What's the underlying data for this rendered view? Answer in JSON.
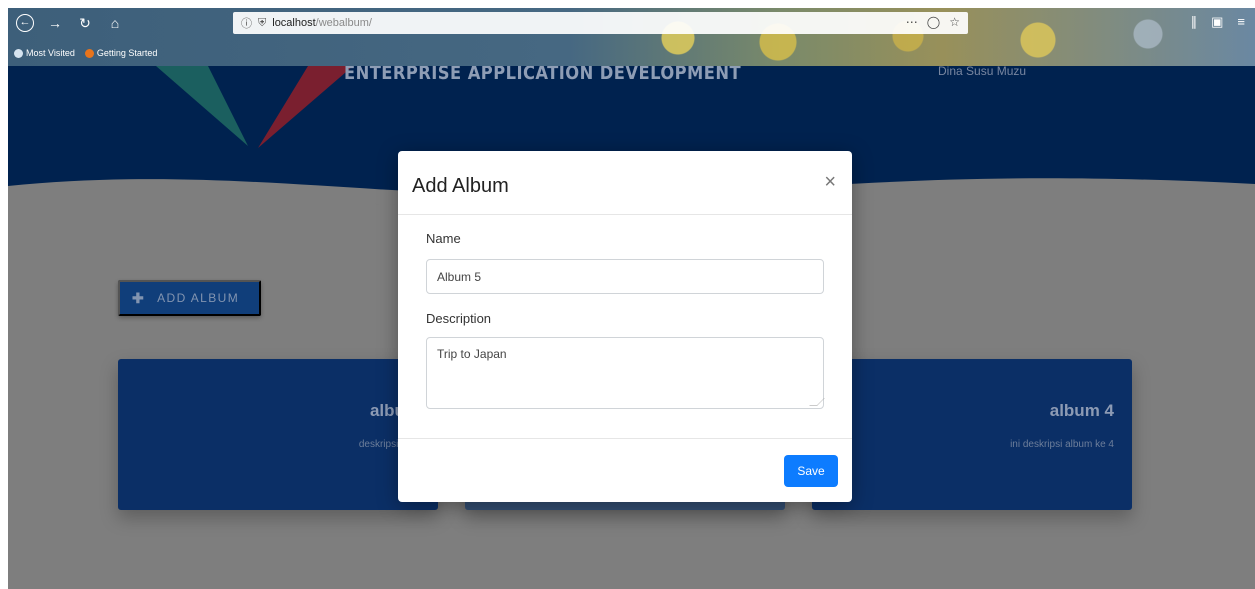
{
  "browser": {
    "url_host": "localhost",
    "url_path": "/webalbum/",
    "bookmarks": [
      "Most Visited",
      "Getting Started"
    ]
  },
  "header": {
    "title": "ENTERPRISE APPLICATION DEVELOPMENT",
    "user_text": "Dina Susu Muzu"
  },
  "actions": {
    "add_album_label": "ADD ALBUM"
  },
  "albums": [
    {
      "title": "album",
      "description": "deskripsi albu"
    },
    {
      "title": "",
      "description": ""
    },
    {
      "title": "album 4",
      "description": "ini deskripsi album ke 4"
    }
  ],
  "modal": {
    "title": "Add Album",
    "close_glyph": "×",
    "name_label": "Name",
    "name_value": "Album 5",
    "description_label": "Description",
    "description_value": "Trip to Japan",
    "save_label": "Save"
  },
  "colors": {
    "header_bg": "#00224f",
    "card_bg": "#0b2f66",
    "save_button": "#0d7cff",
    "overlay": "#7e7e7e"
  }
}
